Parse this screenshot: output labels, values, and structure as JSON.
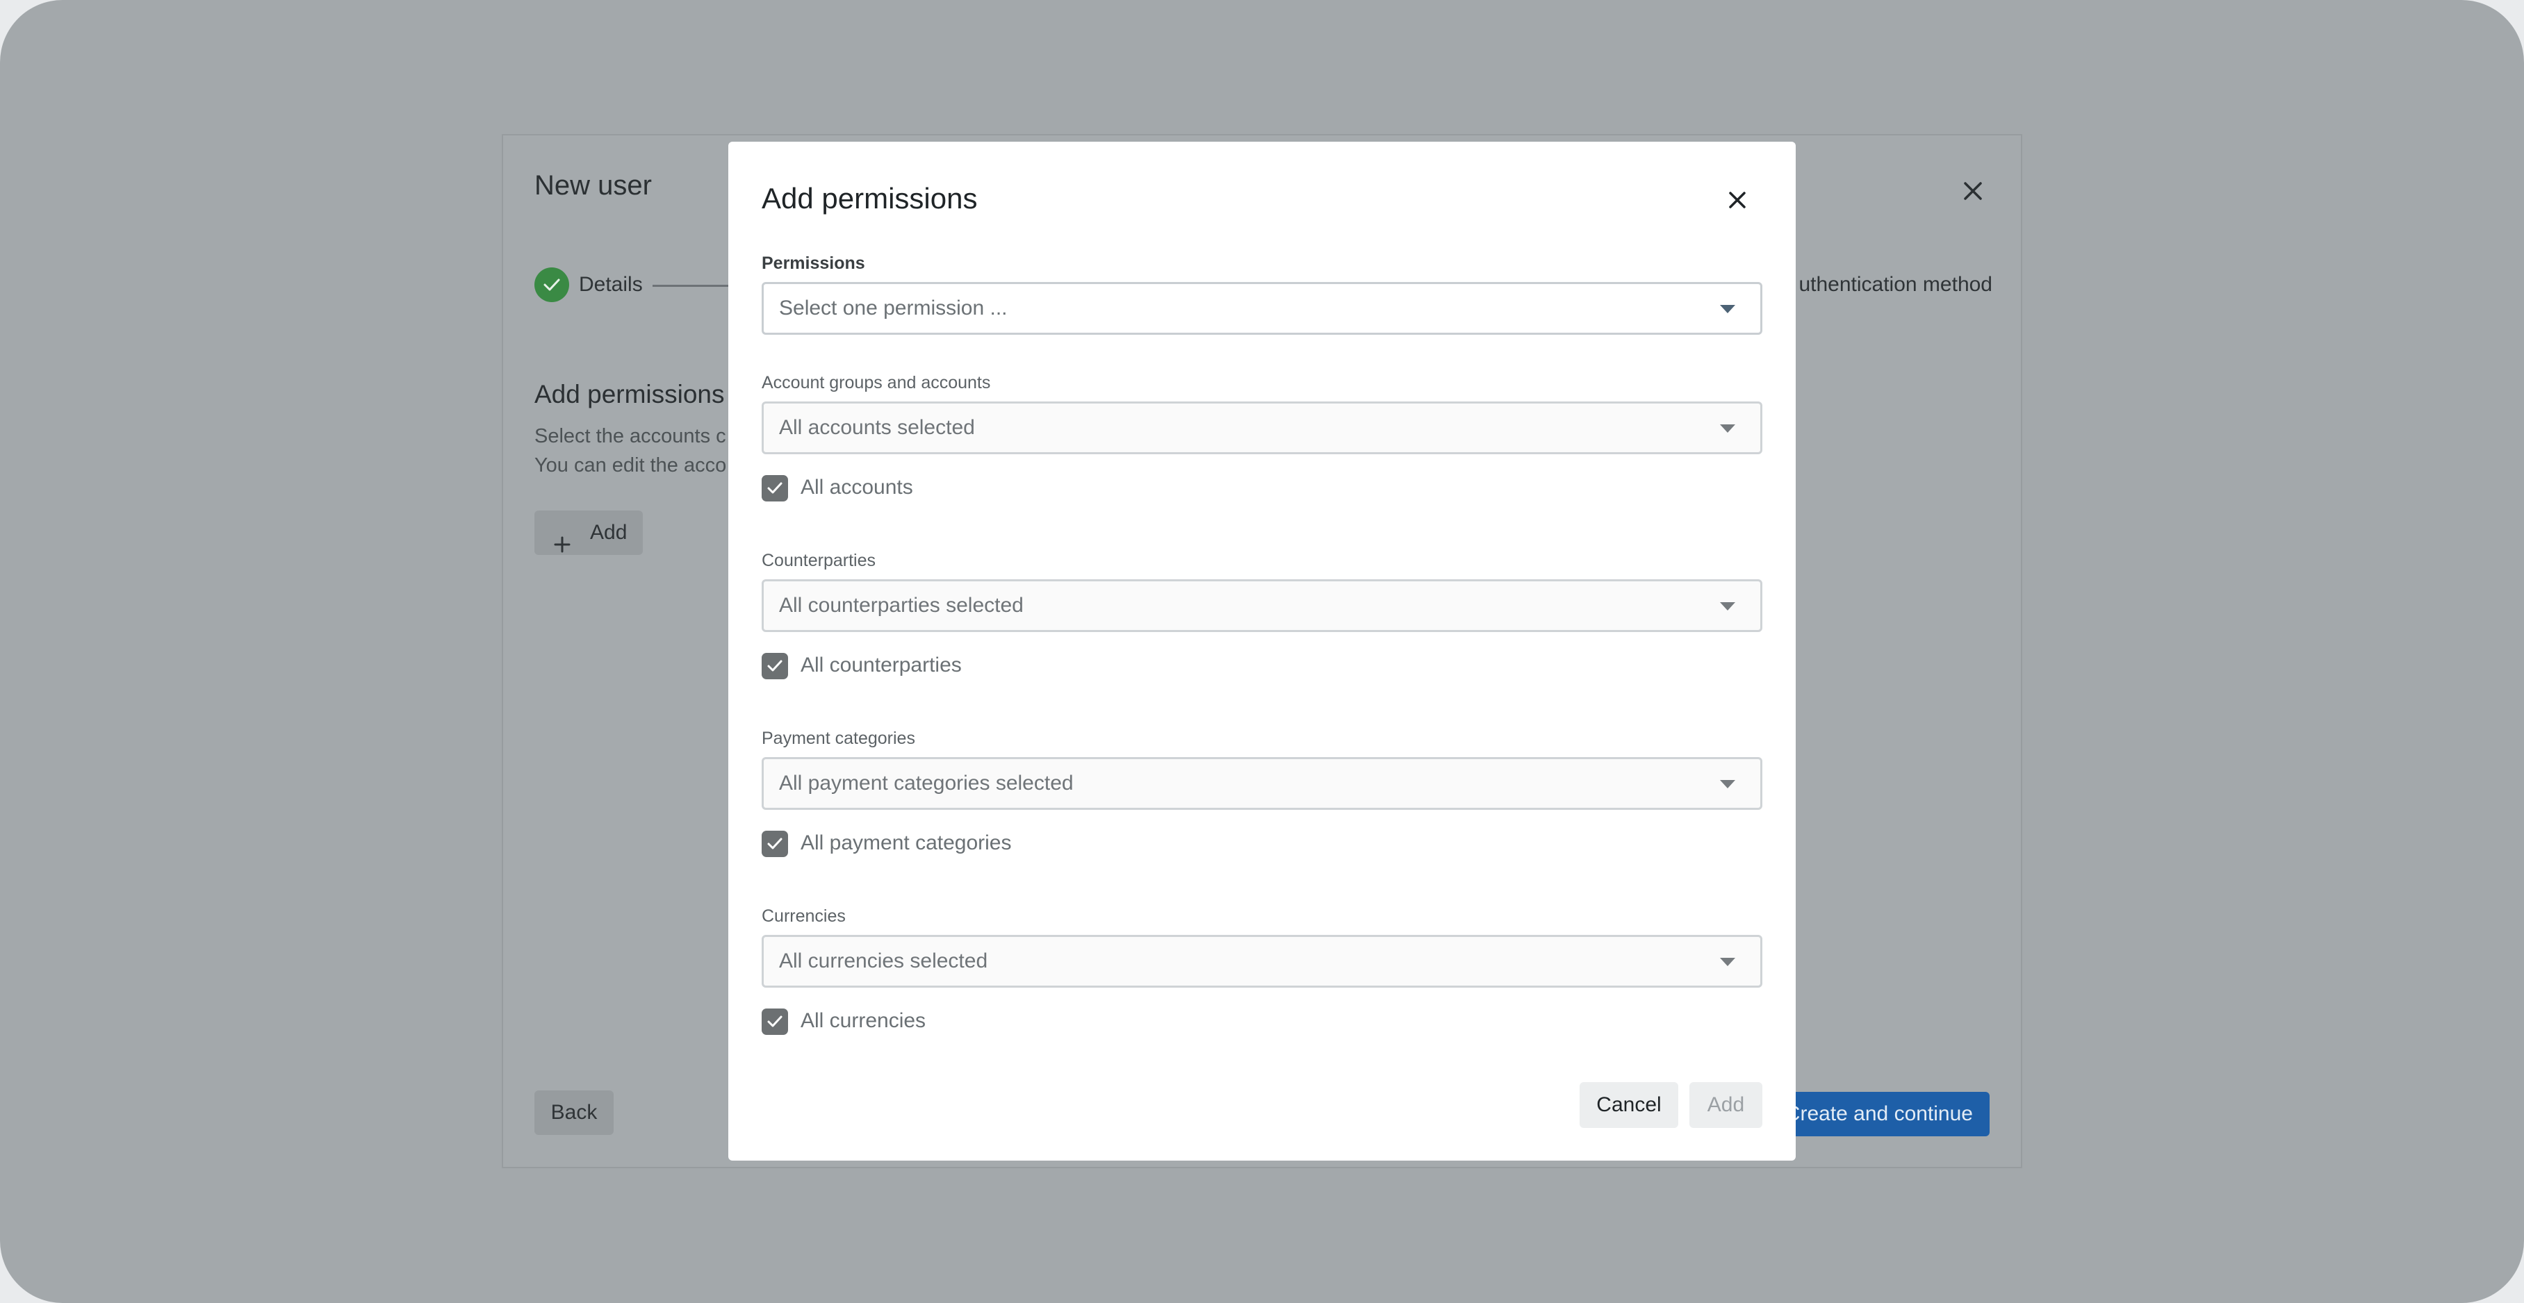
{
  "wizard": {
    "title": "New user",
    "steps": [
      {
        "label": "Details",
        "state": "done"
      },
      {
        "label": "Authentication method",
        "state": "pending"
      }
    ],
    "step_right_visible": "uthentication method",
    "section_title": "Add permissions",
    "description_lines": [
      "Select the accounts c",
      "You can edit the acco"
    ],
    "add_button": "Add",
    "back_button": "Back",
    "create_button": "Create and continue",
    "create_button_visible": "Create and continue"
  },
  "modal": {
    "title": "Add permissions",
    "fields": [
      {
        "label": "Permissions",
        "placeholder": "Select one permission ...",
        "checkbox": null
      },
      {
        "label": "Account groups and accounts",
        "value": "All accounts selected",
        "checkbox": {
          "label": "All accounts",
          "checked": true
        }
      },
      {
        "label": "Counterparties",
        "value": "All counterparties selected",
        "checkbox": {
          "label": "All counterparties",
          "checked": true
        }
      },
      {
        "label": "Payment categories",
        "value": "All payment categories selected",
        "checkbox": {
          "label": "All payment categories",
          "checked": true
        }
      },
      {
        "label": "Currencies",
        "value": "All currencies selected",
        "checkbox": {
          "label": "All currencies",
          "checked": true
        }
      }
    ],
    "cancel_button": "Cancel",
    "add_button": "Add"
  },
  "colors": {
    "accent_blue": "#1e5fa8",
    "success_green": "#3a8a44",
    "overlay": "#a3a8ab"
  }
}
